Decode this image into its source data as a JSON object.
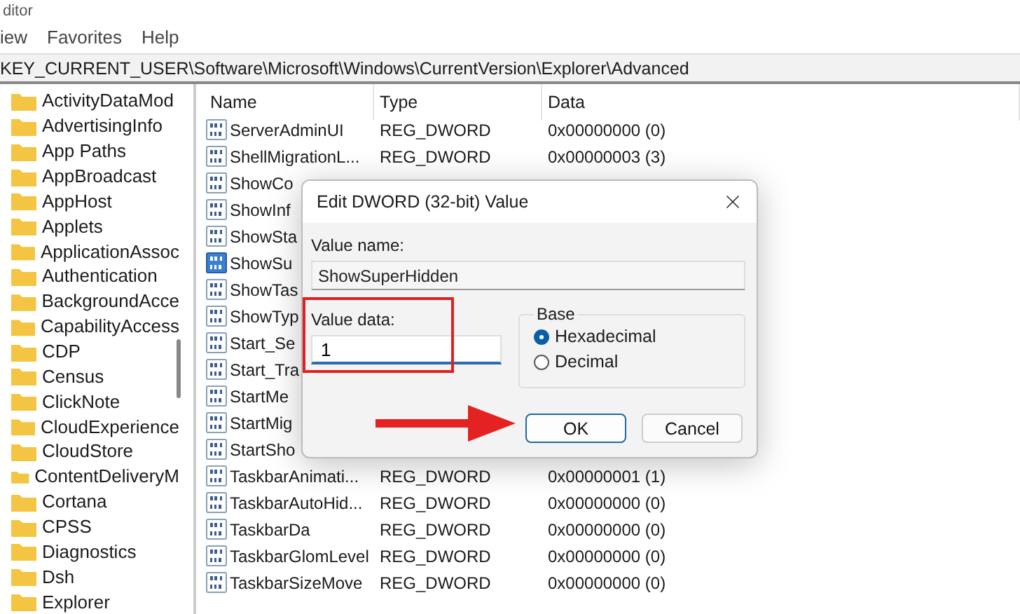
{
  "window": {
    "title": "ditor"
  },
  "menu": [
    "iew",
    "Favorites",
    "Help"
  ],
  "address": "KEY_CURRENT_USER\\Software\\Microsoft\\Windows\\CurrentVersion\\Explorer\\Advanced",
  "tree": [
    "ActivityDataMod",
    "AdvertisingInfo",
    "App Paths",
    "AppBroadcast",
    "AppHost",
    "Applets",
    "ApplicationAssoc",
    "Authentication",
    "BackgroundAcce",
    "CapabilityAccess",
    "CDP",
    "Census",
    "ClickNote",
    "CloudExperience",
    "CloudStore",
    "ContentDeliveryM",
    "Cortana",
    "CPSS",
    "Diagnostics",
    "Dsh",
    "Explorer"
  ],
  "table": {
    "columns": [
      "Name",
      "Type",
      "Data"
    ],
    "rows": [
      {
        "name": "ServerAdminUI",
        "type": "REG_DWORD",
        "data": "0x00000000 (0)",
        "selected": false
      },
      {
        "name": "ShellMigrationL...",
        "type": "REG_DWORD",
        "data": "0x00000003 (3)",
        "selected": false
      },
      {
        "name": "ShowCo",
        "selected": false
      },
      {
        "name": "ShowInf",
        "selected": false
      },
      {
        "name": "ShowSta",
        "selected": false
      },
      {
        "name": "ShowSu",
        "selected": true
      },
      {
        "name": "ShowTas",
        "selected": false
      },
      {
        "name": "ShowTyp",
        "selected": false
      },
      {
        "name": "Start_Se",
        "selected": false
      },
      {
        "name": "Start_Tra",
        "selected": false
      },
      {
        "name": "StartMe",
        "selected": false
      },
      {
        "name": "StartMig",
        "selected": false
      },
      {
        "name": "StartSho",
        "selected": false
      },
      {
        "name": "TaskbarAnimati...",
        "type": "REG_DWORD",
        "data": "0x00000001 (1)",
        "selected": false
      },
      {
        "name": "TaskbarAutoHid...",
        "type": "REG_DWORD",
        "data": "0x00000000 (0)",
        "selected": false
      },
      {
        "name": "TaskbarDa",
        "type": "REG_DWORD",
        "data": "0x00000000 (0)",
        "selected": false
      },
      {
        "name": "TaskbarGlomLevel",
        "type": "REG_DWORD",
        "data": "0x00000000 (0)",
        "selected": false
      },
      {
        "name": "TaskbarSizeMove",
        "type": "REG_DWORD",
        "data": "0x00000000 (0)",
        "selected": false
      }
    ]
  },
  "dialog": {
    "title": "Edit DWORD (32-bit) Value",
    "name_label": "Value name:",
    "name_value": "ShowSuperHidden",
    "data_label": "Value data:",
    "data_value": "1",
    "base_label": "Base",
    "base_options": [
      {
        "label": "Hexadecimal",
        "selected": true
      },
      {
        "label": "Decimal",
        "selected": false
      }
    ],
    "buttons": [
      {
        "label": "OK",
        "default": true
      },
      {
        "label": "Cancel",
        "default": false
      }
    ]
  }
}
